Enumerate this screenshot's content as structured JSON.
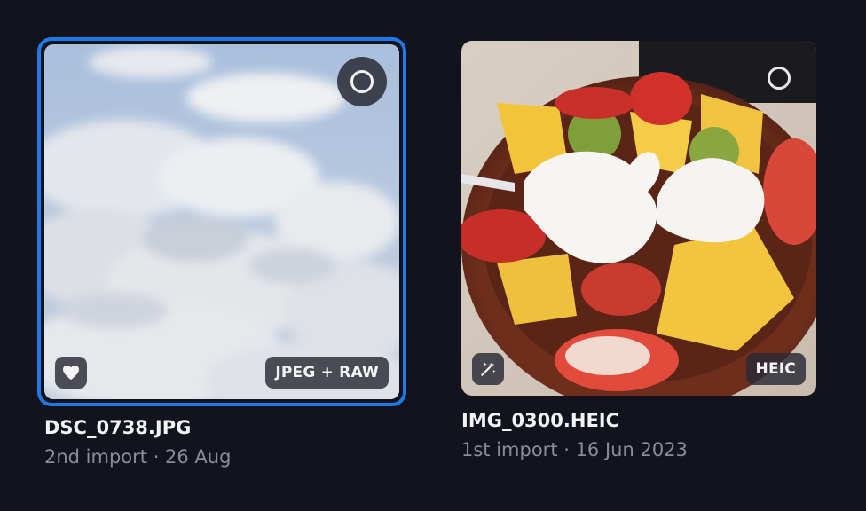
{
  "photos": [
    {
      "filename": "DSC_0738.JPG",
      "meta": "2nd import · 26 Aug",
      "format_badge": "JPEG + RAW",
      "selected": true,
      "corner_icon": "heart-icon",
      "accent_color": "#1f7ae8"
    },
    {
      "filename": "IMG_0300.HEIC",
      "meta": "1st import · 16 Jun 2023",
      "format_badge": "HEIC",
      "selected": false,
      "corner_icon": "magic-wand-icon"
    }
  ]
}
